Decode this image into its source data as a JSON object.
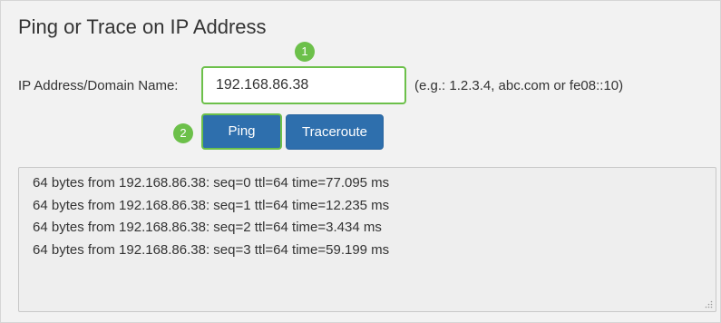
{
  "page": {
    "title": "Ping or Trace on IP Address"
  },
  "form": {
    "ip_label": "IP Address/Domain Name:",
    "ip_value": "192.168.86.38",
    "hint": "(e.g.: 1.2.3.4, abc.com or fe08::10)"
  },
  "buttons": {
    "ping": "Ping",
    "traceroute": "Traceroute"
  },
  "steps": {
    "step1": "1",
    "step2": "2"
  },
  "output": {
    "lines": [
      "64 bytes from 192.168.86.38: seq=0 ttl=64 time=77.095 ms",
      "64 bytes from 192.168.86.38: seq=1 ttl=64 time=12.235 ms",
      "64 bytes from 192.168.86.38: seq=2 ttl=64 time=3.434 ms",
      "64 bytes from 192.168.86.38: seq=3 ttl=64 time=59.199 ms"
    ]
  },
  "colors": {
    "accent_green": "#6cc04a",
    "button_blue": "#2e6fad",
    "panel_bg": "#f2f2f2"
  },
  "icons": {
    "resize": "resize-grip-icon"
  }
}
